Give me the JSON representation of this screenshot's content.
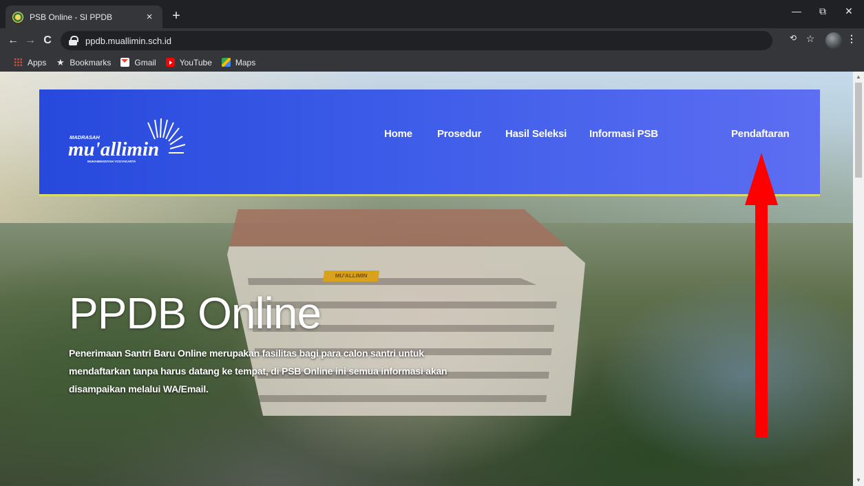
{
  "browser": {
    "tab": {
      "title": "PSB Online - SI PPDB",
      "close": "×"
    },
    "new_tab": "+",
    "window_controls": {
      "minimize": "—",
      "restore": "⧉",
      "close": "✕"
    },
    "nav": {
      "back": "←",
      "forward": "→",
      "reload": "C"
    },
    "url": "ppdb.muallimin.sch.id",
    "bookmarks": [
      "Apps",
      "Bookmarks",
      "Gmail",
      "YouTube",
      "Maps"
    ]
  },
  "site": {
    "logo": {
      "small": "MADRASAH",
      "main": "mu'allimin",
      "sub": "MUHAMMADIYAH YOGYAKARTA"
    },
    "nav": [
      "Home",
      "Prosedur",
      "Hasil Seleksi",
      "Informasi PSB",
      "Pendaftaran"
    ],
    "building_sign": "MU'ALLIMIN"
  },
  "hero": {
    "title": "PPDB Online",
    "description": "Penerimaan Santri Baru Online merupakan fasilitas bagi para calon santri untuk mendaftarkan tanpa harus datang ke tempat, di PSB Online ini semua informasi akan disampaikan melalui WA/Email."
  },
  "colors": {
    "header_gradient_start": "#2749dc",
    "header_gradient_end": "#5d6ef2",
    "header_underline": "#d8dd6a",
    "annotation_arrow": "#ff0000"
  }
}
